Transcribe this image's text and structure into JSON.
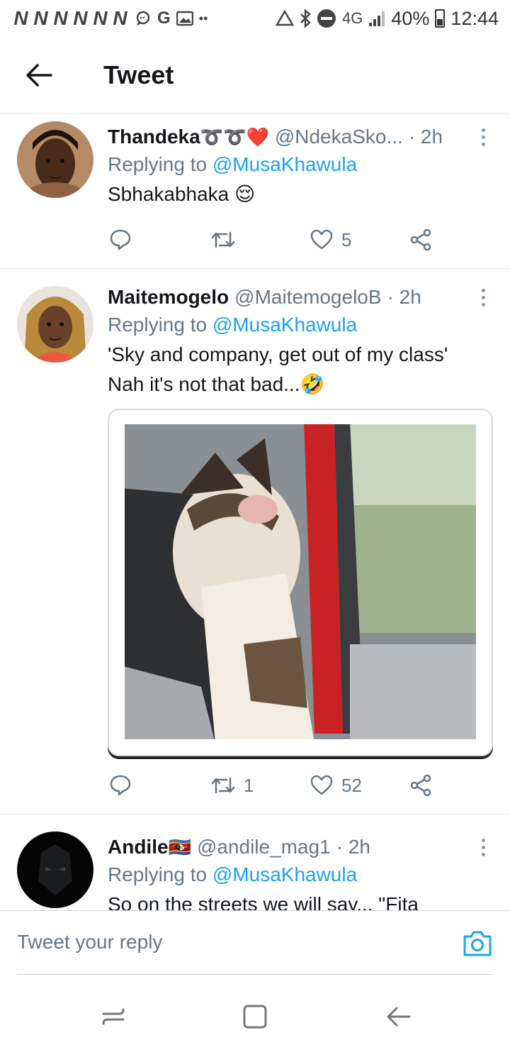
{
  "status_bar": {
    "notification_letters": [
      "N",
      "N",
      "N",
      "N",
      "N",
      "N"
    ],
    "notification_icons": [
      "chat-icon",
      "google-icon",
      "gallery-icon",
      "more-dots-icon",
      "recycle-icon",
      "bluetooth-icon",
      "dnd-icon"
    ],
    "network": "4G",
    "battery": "40%",
    "battery_level": 0.4,
    "time": "12:44"
  },
  "header": {
    "title": "Tweet"
  },
  "tweets": [
    {
      "display_name": "Thandeka",
      "name_emojis": "➰➰❤️",
      "handle": "@NdekaSko...",
      "time": "· 2h",
      "replying_label": "Replying to ",
      "replying_to": "@MusaKhawula",
      "text": "Sbhakabhaka 😌",
      "reply_count": "",
      "retweet_count": "",
      "like_count": "5"
    },
    {
      "display_name": "Maitemogelo",
      "handle": "@MaitemogeloB",
      "time": "· 2h",
      "replying_label": "Replying to ",
      "replying_to": "@MusaKhawula",
      "text": "'Sky and company, get out of my class'\nNah it's not that bad...🤣",
      "reply_count": "",
      "retweet_count": "1",
      "like_count": "52"
    },
    {
      "display_name": "Andile",
      "name_emojis": "🇸🇿",
      "handle": "@andile_mag1",
      "time": "· 2h",
      "replying_label": "Replying to ",
      "replying_to": "@MusaKhawula",
      "text": "So on the streets we will say... \"Fita"
    }
  ],
  "composer": {
    "placeholder": "Tweet your reply"
  },
  "colors": {
    "accent": "#1da1f2",
    "muted": "#657786",
    "divider": "#e1e8ed"
  }
}
